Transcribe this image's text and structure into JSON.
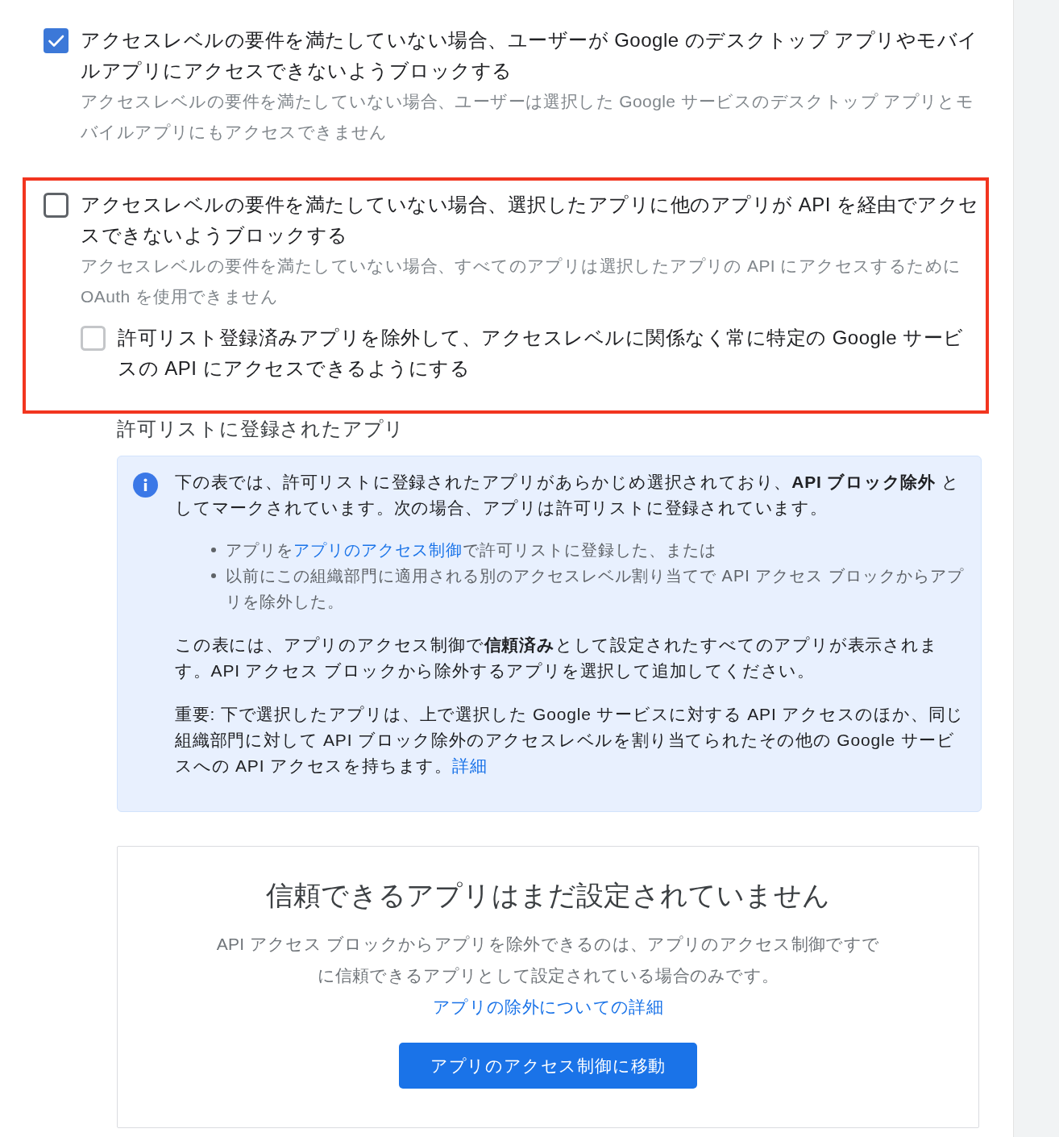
{
  "options": [
    {
      "checked": true,
      "highlighted": false,
      "label": "アクセスレベルの要件を満たしていない場合、ユーザーが Google のデスクトップ アプリやモバイルアプリにアクセスできないようブロックする",
      "description": "アクセスレベルの要件を満たしていない場合、ユーザーは選択した Google サービスのデスクトップ アプリとモバイルアプリにもアクセスできません"
    },
    {
      "checked": false,
      "highlighted": true,
      "label": "アクセスレベルの要件を満たしていない場合、選択したアプリに他のアプリが API を経由でアクセスできないようブロックする",
      "description": "アクセスレベルの要件を満たしていない場合、すべてのアプリは選択したアプリの API にアクセスするために OAuth を使用できません",
      "suboptions": [
        {
          "checked": false,
          "label": "許可リスト登録済みアプリを除外して、アクセスレベルに関係なく常に特定の Google サービスの API にアクセスできるようにする"
        }
      ]
    }
  ],
  "allowlist": {
    "heading": "許可リストに登録されたアプリ",
    "info": {
      "blocks": [
        {
          "kind": "paragraph",
          "parts": [
            {
              "kind": "text",
              "text": "下の表では、許可リストに登録されたアプリがあらかじめ選択されており、**API ブロック除外** としてマークされています。次の場合、アプリは許可リストに登録されています。"
            }
          ]
        },
        {
          "kind": "bullets",
          "items": [
            {
              "parts": [
                {
                  "kind": "text",
                  "text": "アプリを"
                },
                {
                  "kind": "link",
                  "text": "アプリのアクセス制御"
                },
                {
                  "kind": "text",
                  "text": "で許可リストに登録した、または"
                }
              ]
            },
            {
              "parts": [
                {
                  "kind": "text",
                  "text": "以前にこの組織部門に適用される別のアクセスレベル割り当てで API アクセス ブロックからアプリを除外した。"
                }
              ]
            }
          ]
        },
        {
          "kind": "paragraph",
          "parts": [
            {
              "kind": "text",
              "text": "この表には、アプリのアクセス制御で**信頼済み**として設定されたすべてのアプリが表示されます。API アクセス ブロックから除外するアプリを選択して追加してください。"
            }
          ]
        },
        {
          "kind": "paragraph",
          "parts": [
            {
              "kind": "text",
              "text": "重要: 下で選択したアプリは、上で選択した Google サービスに対する API アクセスのほか、同じ組織部門に対して API ブロック除外のアクセスレベルを割り当てられたその他の Google サービスへの API アクセスを持ちます。"
            },
            {
              "kind": "link",
              "text": "詳細"
            }
          ]
        }
      ]
    }
  },
  "empty_state": {
    "title": "信頼できるアプリはまだ設定されていません",
    "parts": [
      {
        "kind": "text",
        "text": "API アクセス ブロックからアプリを除外できるのは、アプリのアクセス制御ですでに信頼できるアプリとして設定されている場合のみです。"
      },
      {
        "kind": "link",
        "text": "アプリの除外についての詳細"
      }
    ],
    "button": "アプリのアクセス制御に移動"
  }
}
